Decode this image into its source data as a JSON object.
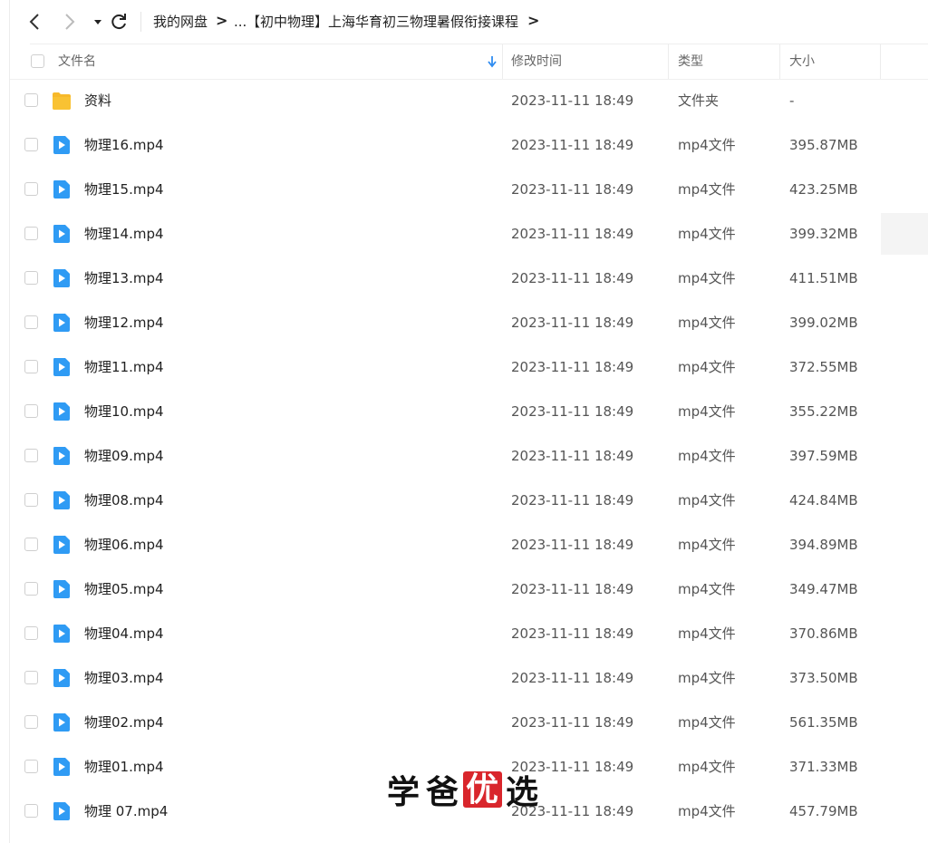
{
  "breadcrumb": {
    "root": "我的网盘",
    "separator": ">",
    "ellipsis": "...",
    "current": "【初中物理】上海华育初三物理暑假衔接课程"
  },
  "columns": {
    "name": "文件名",
    "modified": "修改时间",
    "type": "类型",
    "size": "大小"
  },
  "files": [
    {
      "name": "资料",
      "date": "2023-11-11 18:49",
      "type": "文件夹",
      "size": "-",
      "icon": "folder-icon"
    },
    {
      "name": "物理16.mp4",
      "date": "2023-11-11 18:49",
      "type": "mp4文件",
      "size": "395.87MB",
      "icon": "video-file-icon"
    },
    {
      "name": "物理15.mp4",
      "date": "2023-11-11 18:49",
      "type": "mp4文件",
      "size": "423.25MB",
      "icon": "video-file-icon"
    },
    {
      "name": "物理14.mp4",
      "date": "2023-11-11 18:49",
      "type": "mp4文件",
      "size": "399.32MB",
      "icon": "video-file-icon"
    },
    {
      "name": "物理13.mp4",
      "date": "2023-11-11 18:49",
      "type": "mp4文件",
      "size": "411.51MB",
      "icon": "video-file-icon"
    },
    {
      "name": "物理12.mp4",
      "date": "2023-11-11 18:49",
      "type": "mp4文件",
      "size": "399.02MB",
      "icon": "video-file-icon"
    },
    {
      "name": "物理11.mp4",
      "date": "2023-11-11 18:49",
      "type": "mp4文件",
      "size": "372.55MB",
      "icon": "video-file-icon"
    },
    {
      "name": "物理10.mp4",
      "date": "2023-11-11 18:49",
      "type": "mp4文件",
      "size": "355.22MB",
      "icon": "video-file-icon"
    },
    {
      "name": "物理09.mp4",
      "date": "2023-11-11 18:49",
      "type": "mp4文件",
      "size": "397.59MB",
      "icon": "video-file-icon"
    },
    {
      "name": "物理08.mp4",
      "date": "2023-11-11 18:49",
      "type": "mp4文件",
      "size": "424.84MB",
      "icon": "video-file-icon"
    },
    {
      "name": "物理06.mp4",
      "date": "2023-11-11 18:49",
      "type": "mp4文件",
      "size": "394.89MB",
      "icon": "video-file-icon"
    },
    {
      "name": "物理05.mp4",
      "date": "2023-11-11 18:49",
      "type": "mp4文件",
      "size": "349.47MB",
      "icon": "video-file-icon"
    },
    {
      "name": "物理04.mp4",
      "date": "2023-11-11 18:49",
      "type": "mp4文件",
      "size": "370.86MB",
      "icon": "video-file-icon"
    },
    {
      "name": "物理03.mp4",
      "date": "2023-11-11 18:49",
      "type": "mp4文件",
      "size": "373.50MB",
      "icon": "video-file-icon"
    },
    {
      "name": "物理02.mp4",
      "date": "2023-11-11 18:49",
      "type": "mp4文件",
      "size": "561.35MB",
      "icon": "video-file-icon"
    },
    {
      "name": "物理01.mp4",
      "date": "2023-11-11 18:49",
      "type": "mp4文件",
      "size": "371.33MB",
      "icon": "video-file-icon"
    },
    {
      "name": "物理 07.mp4",
      "date": "2023-11-11 18:49",
      "type": "mp4文件",
      "size": "457.79MB",
      "icon": "video-file-icon"
    }
  ],
  "watermark": {
    "chars": [
      "学",
      "爸",
      "优",
      "选"
    ],
    "highlight_color": "#d9262c"
  },
  "colors": {
    "folder": "#f9c233",
    "video": "#2f9bf4",
    "text": "#222222",
    "muted": "#555555"
  }
}
